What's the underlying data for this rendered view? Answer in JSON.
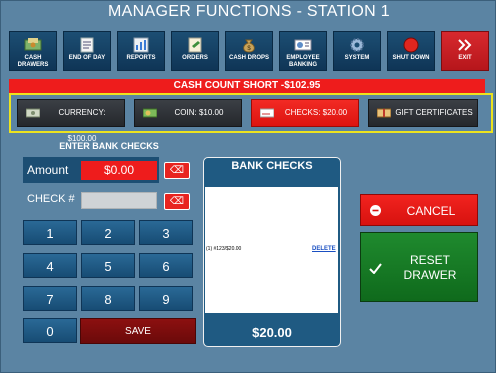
{
  "window": {
    "title": "MANAGER FUNCTIONS - STATION 1"
  },
  "toolbar": {
    "buttons": [
      {
        "label": "CASH DRAWERS",
        "icon": "cash-drawer-icon"
      },
      {
        "label": "END OF DAY",
        "icon": "end-of-day-icon"
      },
      {
        "label": "REPORTS",
        "icon": "reports-icon"
      },
      {
        "label": "ORDERS",
        "icon": "orders-icon"
      },
      {
        "label": "CASH DROPS",
        "icon": "money-bag-icon"
      },
      {
        "label": "EMPLOYEE BANKING",
        "icon": "employee-banking-icon"
      },
      {
        "label": "SYSTEM",
        "icon": "gear-icon"
      },
      {
        "label": "SHUT DOWN",
        "icon": "shutdown-icon"
      },
      {
        "label": "EXIT",
        "icon": "exit-icon"
      }
    ]
  },
  "status": {
    "short_text": "CASH COUNT SHORT -$102.95"
  },
  "tenders": [
    {
      "label": "CURRENCY: $100.00",
      "icon": "currency-icon"
    },
    {
      "label": "COIN: $10.00",
      "icon": "coin-icon"
    },
    {
      "label": "CHECKS: $20.00",
      "icon": "check-icon"
    },
    {
      "label": "GIFT CERTIFICATES",
      "icon": "gift-certificate-icon"
    }
  ],
  "entry": {
    "header": "ENTER BANK CHECKS",
    "amount_label": "Amount",
    "amount_value": "$0.00",
    "check_label": "CHECK #",
    "check_value": ""
  },
  "keypad": {
    "keys": [
      "1",
      "2",
      "3",
      "4",
      "5",
      "6",
      "7",
      "8",
      "9",
      "0"
    ],
    "save_label": "SAVE"
  },
  "bank_checks": {
    "title": "BANK CHECKS",
    "items": [
      {
        "text": "(1) #123/$20.00",
        "delete_label": "DELETE"
      }
    ],
    "total": "$20.00"
  },
  "actions": {
    "cancel_label": "CANCEL",
    "reset_label_line1": "RESET",
    "reset_label_line2": "DRAWER"
  },
  "colors": {
    "background": "#5b84a3",
    "button_blue": "#1c4e73",
    "alert_red": "#ee1c1c",
    "highlight_yellow": "#ece31e",
    "reset_green": "#1f8a2e"
  }
}
